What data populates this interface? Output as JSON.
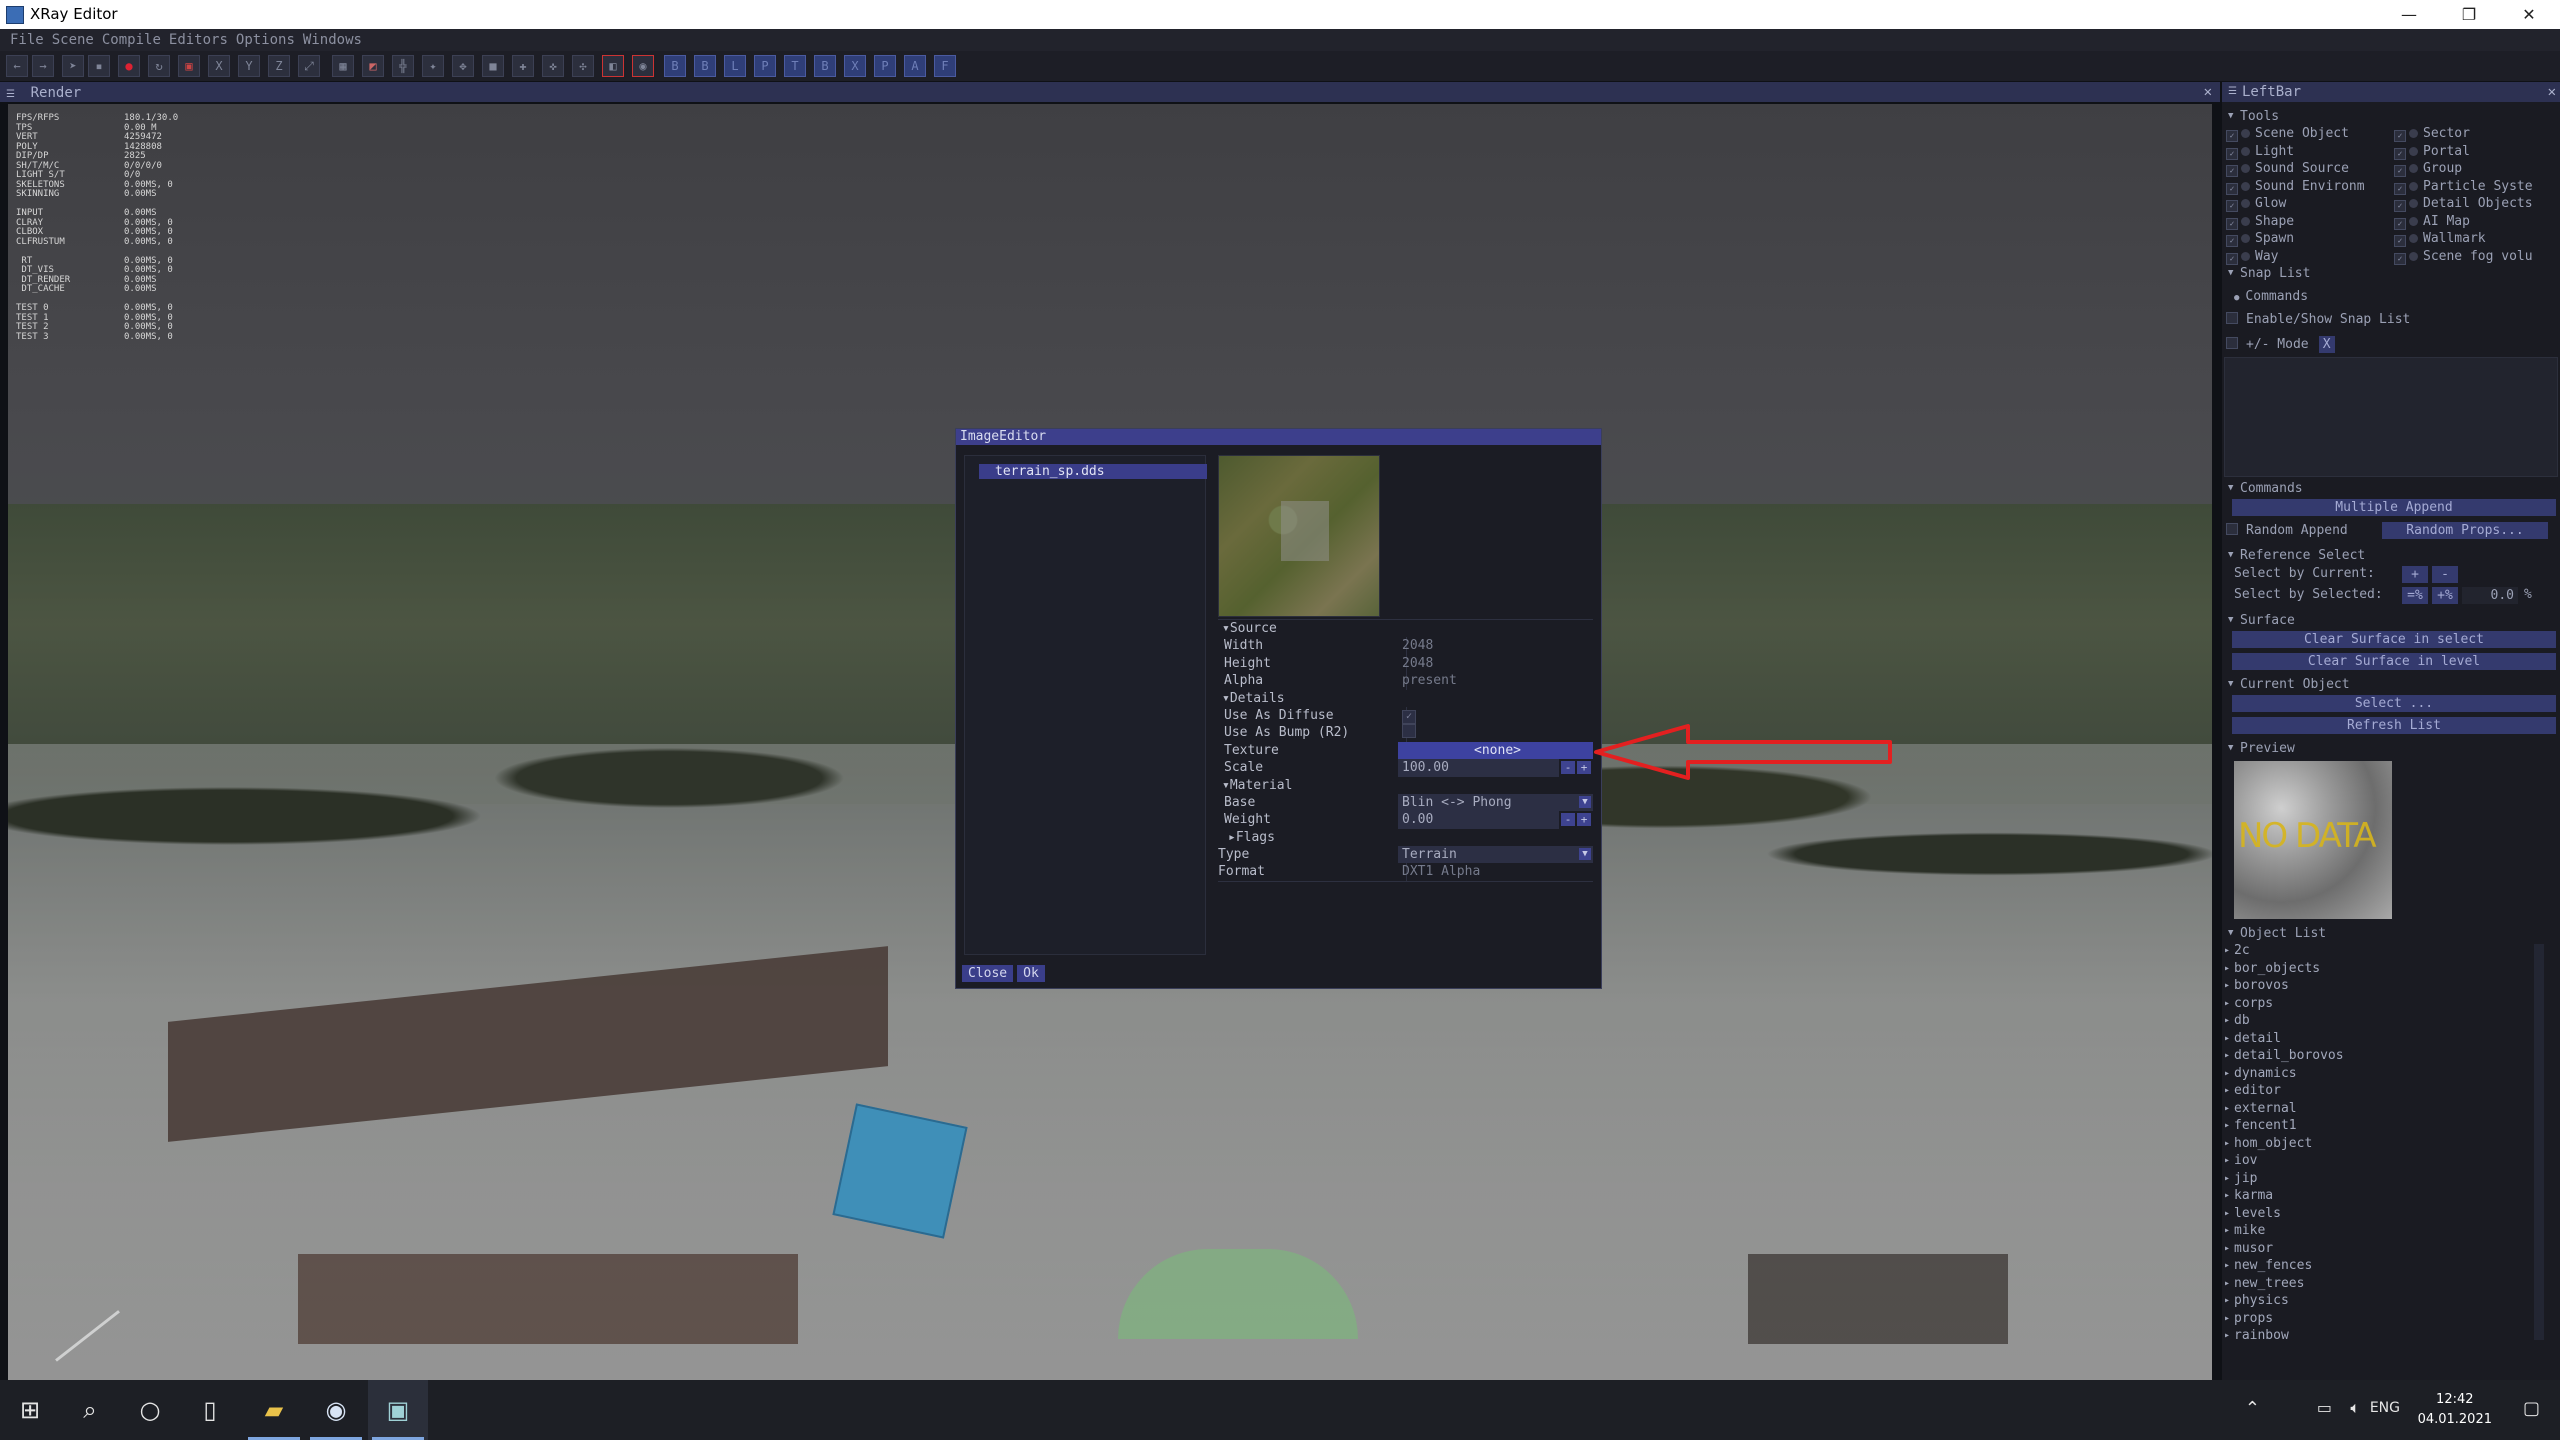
{
  "window": {
    "title": "XRay Editor",
    "min_label": "—",
    "max_label": "❐",
    "close_label": "✕"
  },
  "menu": [
    "File",
    "Scene",
    "Compile",
    "Editors",
    "Options",
    "Windows"
  ],
  "toolbar_letters": [
    "B",
    "B",
    "L",
    "P",
    "T",
    "B",
    "X",
    "P",
    "A",
    "F"
  ],
  "render": {
    "title": "Render"
  },
  "stats": [
    [
      "FPS/RFPS",
      "180.1/30.0"
    ],
    [
      "TPS",
      "0.00 M"
    ],
    [
      "VERT",
      "4259472"
    ],
    [
      "POLY",
      "1428808"
    ],
    [
      "DIP/DP",
      "2825"
    ],
    [
      "SH/T/M/C",
      "0/0/0/0"
    ],
    [
      "LIGHT S/T",
      "0/0"
    ],
    [
      "SKELETONS",
      "0.00MS, 0"
    ],
    [
      "SKINNING",
      "0.00MS"
    ],
    [
      "",
      ""
    ],
    [
      "INPUT",
      "0.00MS"
    ],
    [
      "CLRAY",
      "0.00MS, 0"
    ],
    [
      "CLBOX",
      "0.00MS, 0"
    ],
    [
      "CLFRUSTUM",
      "0.00MS, 0"
    ],
    [
      "",
      ""
    ],
    [
      " RT",
      "0.00MS, 0"
    ],
    [
      " DT_VIS",
      "0.00MS, 0"
    ],
    [
      " DT_RENDER",
      "0.00MS"
    ],
    [
      " DT_CACHE",
      "0.00MS"
    ],
    [
      "",
      ""
    ],
    [
      "TEST 0",
      "0.00MS, 0"
    ],
    [
      "TEST 1",
      "0.00MS, 0"
    ],
    [
      "TEST 2",
      "0.00MS, 0"
    ],
    [
      "TEST 3",
      "0.00MS, 0"
    ]
  ],
  "image_editor": {
    "title": "ImageEditor",
    "file": "terrain_sp.dds",
    "props": {
      "source": "Source",
      "width_label": "Width",
      "width_value": "2048",
      "height_label": "Height",
      "height_value": "2048",
      "alpha_label": "Alpha",
      "alpha_value": "present",
      "details": "Details",
      "use_diffuse_label": "Use As Diffuse",
      "use_diffuse_value": "✓",
      "use_bump_label": "Use As Bump (R2)",
      "texture_label": "Texture",
      "texture_value": "<none>",
      "scale_label": "Scale",
      "scale_value": "100.00",
      "material": "Material",
      "base_label": "Base",
      "base_value": "Blin <-> Phong",
      "weight_label": "Weight",
      "weight_value": "0.00",
      "flags": "Flags",
      "type_label": "Type",
      "type_value": "Terrain",
      "format_label": "Format",
      "format_value": "DXT1 Alpha"
    },
    "close": "Close",
    "ok": "Ok"
  },
  "leftbar": {
    "title": "LeftBar",
    "tools": "Tools",
    "tool_items_left": [
      "Scene Object",
      "Light",
      "Sound Source",
      "Sound Environm",
      "Glow",
      "Shape",
      "Spawn",
      "Way"
    ],
    "tool_items_right": [
      "Sector",
      "Portal",
      "Group",
      "Particle Syste",
      "Detail Objects",
      "AI Map",
      "Wallmark",
      "Scene fog volu"
    ],
    "snap_list": "Snap List",
    "commands_radio": "Commands",
    "enable_snap": "Enable/Show Snap List",
    "mode": "+/- Mode",
    "mode_x": "X",
    "commands": "Commands",
    "multiple_append": "Multiple Append",
    "random_append": "Random Append",
    "random_props": "Random Props...",
    "reference_select": "Reference Select",
    "select_current": "Select by Current:",
    "select_selected": "Select by Selected:",
    "plus": "+",
    "minus": "-",
    "pct_minus": "=%",
    "pct_plus": "+%",
    "select_value": "0.0",
    "pct": "%",
    "surface": "Surface",
    "clear_select": "Clear Surface in select",
    "clear_level": "Clear Surface in level",
    "current_object": "Current Object",
    "select_btn": "Select ...",
    "refresh": "Refresh List",
    "preview": "Preview",
    "no_data": "NO DATA",
    "object_list": "Object List",
    "objects": [
      "2c",
      "bor_objects",
      "borovos",
      "corps",
      "db",
      "detail",
      "detail_borovos",
      "dynamics",
      "editor",
      "external",
      "fencent1",
      "hom_object",
      "iov",
      "jip",
      "karma",
      "levels",
      "mike",
      "musor",
      "new_fences",
      "new_trees",
      "physics",
      "props",
      "rainbow"
    ]
  },
  "taskbar": {
    "lang": "ENG",
    "time": "12:42",
    "date": "04.01.2021"
  }
}
